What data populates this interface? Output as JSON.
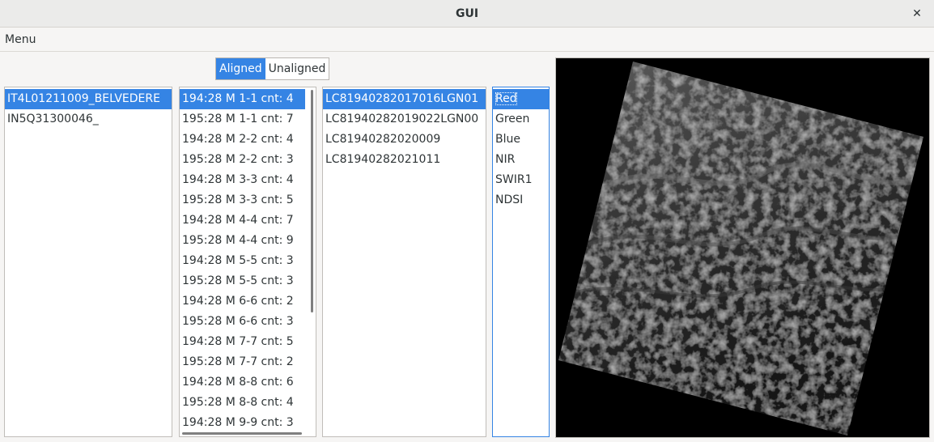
{
  "window": {
    "title": "GUI",
    "close_glyph": "✕"
  },
  "menubar": {
    "menu_label": "Menu"
  },
  "alignment_toggle": {
    "aligned_label": "Aligned",
    "unaligned_label": "Unaligned",
    "selected": "Aligned"
  },
  "sites_list": {
    "items": [
      "IT4L01211009_BELVEDERE",
      "IN5Q31300046_"
    ],
    "selected_index": 0
  },
  "paths_list": {
    "items": [
      "194:28 M 1-1 cnt: 4",
      "195:28 M 1-1 cnt: 7",
      "194:28 M 2-2 cnt: 4",
      "195:28 M 2-2 cnt: 3",
      "194:28 M 3-3 cnt: 4",
      "195:28 M 3-3 cnt: 5",
      "194:28 M 4-4 cnt: 7",
      "195:28 M 4-4 cnt: 9",
      "194:28 M 5-5 cnt: 3",
      "195:28 M 5-5 cnt: 3",
      "194:28 M 6-6 cnt: 2",
      "195:28 M 6-6 cnt: 3",
      "194:28 M 7-7 cnt: 5",
      "195:28 M 7-7 cnt: 2",
      "194:28 M 8-8 cnt: 6",
      "195:28 M 8-8 cnt: 4",
      "194:28 M 9-9 cnt: 3"
    ],
    "selected_index": 0
  },
  "scenes_list": {
    "items": [
      "LC81940282017016LGN01",
      "LC81940282019022LGN00",
      "LC81940282020009",
      "LC81940282021011"
    ],
    "selected_index": 0
  },
  "bands_list": {
    "items": [
      "Red",
      "Green",
      "Blue",
      "NIR",
      "SWIR1",
      "NDSI"
    ],
    "selected_index": 0
  },
  "image_preview": {
    "description_icon": "satellite-image"
  }
}
